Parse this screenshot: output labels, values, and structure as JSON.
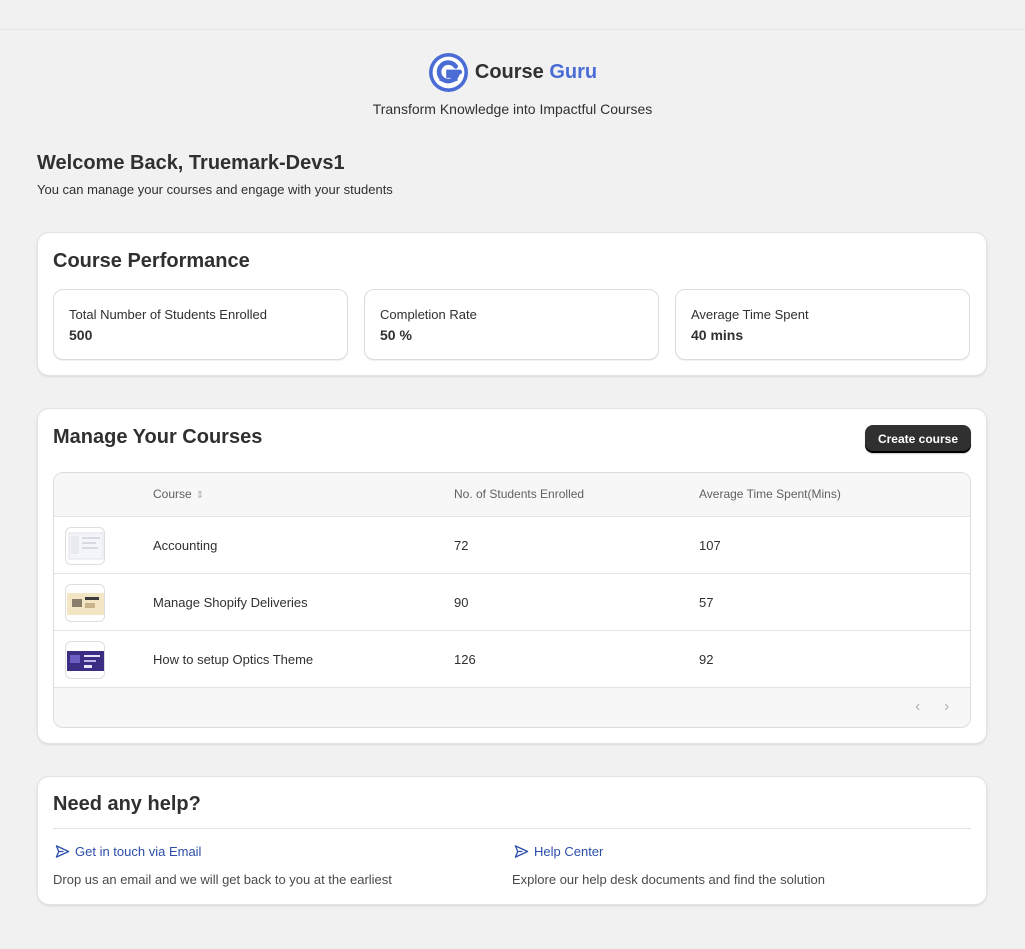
{
  "brand": {
    "name_part1": "Course",
    "name_part2": "Guru",
    "tagline": "Transform Knowledge into Impactful Courses",
    "accent_color": "#4a6cd4"
  },
  "welcome": {
    "title": "Welcome Back, Truemark-Devs1",
    "subtitle": "You can manage your courses and engage with your students"
  },
  "performance": {
    "title": "Course Performance",
    "metrics": [
      {
        "label": "Total Number of Students Enrolled",
        "value": "500"
      },
      {
        "label": "Completion Rate",
        "value": "50 %"
      },
      {
        "label": "Average Time Spent",
        "value": "40 mins"
      }
    ]
  },
  "courses": {
    "title": "Manage Your Courses",
    "create_label": "Create course",
    "columns": {
      "course": "Course",
      "students": "No. of Students Enrolled",
      "time": "Average Time Spent(Mins)"
    },
    "rows": [
      {
        "name": "Accounting",
        "students": "72",
        "time": "107",
        "thumb": "accounting-thumbnail"
      },
      {
        "name": "Manage Shopify Deliveries",
        "students": "90",
        "time": "57",
        "thumb": "shopify-deliveries-thumbnail"
      },
      {
        "name": "How to setup Optics Theme",
        "students": "126",
        "time": "92",
        "thumb": "optics-theme-thumbnail"
      }
    ],
    "pagination": {
      "prev_icon": "chevron-left-icon",
      "next_icon": "chevron-right-icon"
    }
  },
  "help": {
    "title": "Need any help?",
    "email_link": "Get in touch via Email",
    "email_desc": "Drop us an email and we will get back to you at the earliest",
    "center_link": "Help Center",
    "center_desc": "Explore our help desk documents and find the solution",
    "link_icon": "send-icon"
  }
}
